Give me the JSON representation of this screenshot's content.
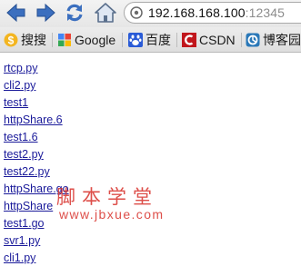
{
  "browser": {
    "url_host": "192.168.168.100",
    "url_port": ":12345"
  },
  "bookmarks": [
    {
      "label": "搜搜",
      "icon": "soso-icon"
    },
    {
      "label": "Google",
      "icon": "google-icon"
    },
    {
      "label": "百度",
      "icon": "baidu-paw-icon"
    },
    {
      "label": "CSDN",
      "icon": "csdn-icon"
    },
    {
      "label": "博客园",
      "icon": "cnblogs-icon"
    }
  ],
  "files": [
    "rtcp.py",
    "cli2.py",
    "test1",
    "httpShare.6",
    "test1.6",
    "test2.py",
    "test22.py",
    "httpShare.go",
    "httpShare",
    "test1.go",
    "svr1.py",
    "cli1.py"
  ],
  "watermark": {
    "top": "脚本学堂",
    "bottom": "www.jbxue.com"
  },
  "colors": {
    "link": "#1a1a9a",
    "nav_blue": "#3366b3",
    "watermark": "#d8302a"
  }
}
